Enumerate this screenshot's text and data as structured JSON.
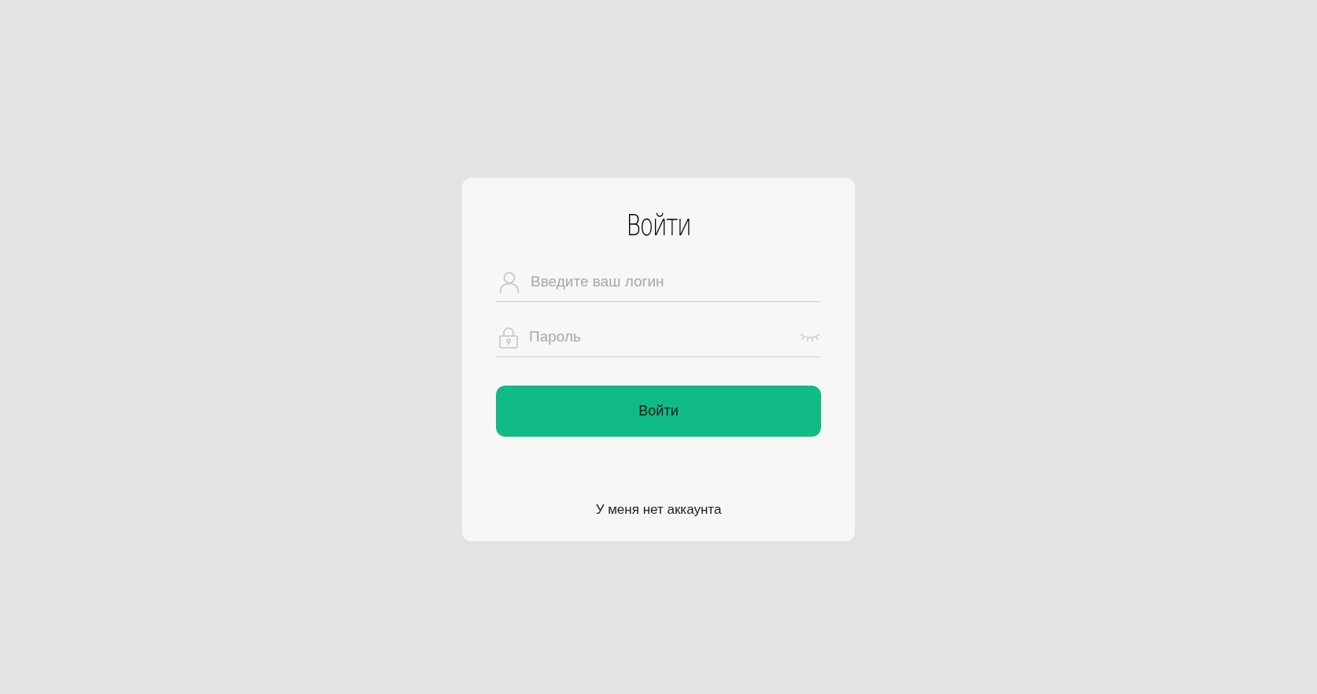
{
  "title": "Войти",
  "fields": [
    {
      "kind": "login",
      "placeholder": "Введите ваш логин"
    },
    {
      "kind": "password",
      "placeholder": "Пароль"
    }
  ],
  "submit": "Войти",
  "register_link": "У меня нет аккаунта"
}
